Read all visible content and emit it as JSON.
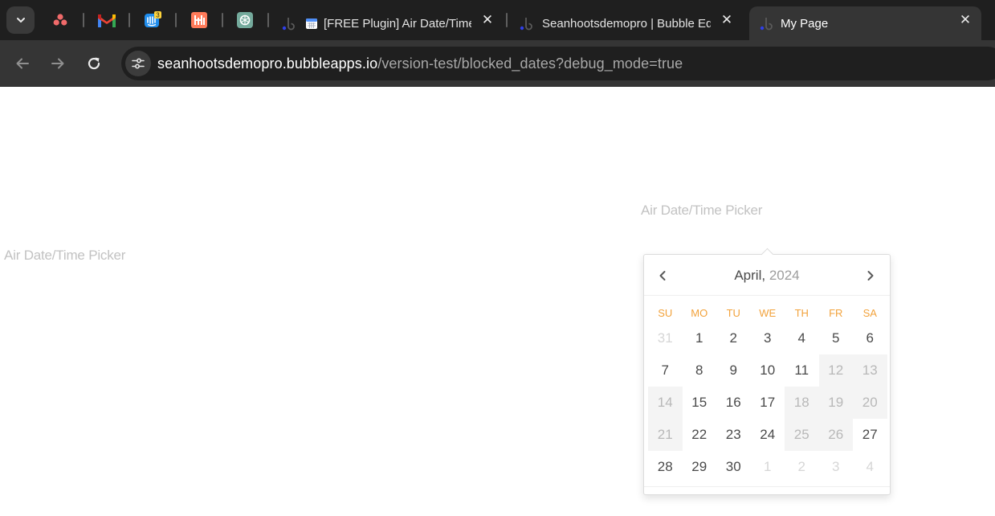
{
  "browser": {
    "pinned_tabs": [
      {
        "icon": "asana-icon",
        "color": "#f06a6a"
      },
      {
        "icon": "gmail-icon",
        "color": "#ea4335"
      },
      {
        "icon": "intercom-icon",
        "color": "#1f8ded",
        "badge": "3"
      },
      {
        "icon": "hubspot-icon",
        "color": "#ff7a59"
      },
      {
        "icon": "chatgpt-icon",
        "color": "#74aa9c"
      }
    ],
    "tabs": [
      {
        "title": "[FREE Plugin] Air Date/Time",
        "icon": "calendar-icon"
      },
      {
        "title": "Seanhootsdemopro | Bubble Ed",
        "icon": "bubble-icon"
      },
      {
        "title": "My Page",
        "icon": "bubble-icon",
        "active": true
      }
    ],
    "close_glyph": "✕",
    "url_host": "seanhootsdemopro.bubbleapps.io",
    "url_path": "/version-test/blocked_dates?debug_mode=true"
  },
  "page": {
    "left_input_placeholder": "Air Date/Time Picker",
    "right_input_placeholder": "Air Date/Time Picker"
  },
  "datepicker": {
    "month": "April,",
    "year": "2024",
    "weekdays": [
      "SU",
      "MO",
      "TU",
      "WE",
      "TH",
      "FR",
      "SA"
    ],
    "accent_color": "#f2a23b",
    "days": [
      {
        "label": "31",
        "state": "other"
      },
      {
        "label": "1",
        "state": "normal"
      },
      {
        "label": "2",
        "state": "normal"
      },
      {
        "label": "3",
        "state": "normal"
      },
      {
        "label": "4",
        "state": "normal"
      },
      {
        "label": "5",
        "state": "normal"
      },
      {
        "label": "6",
        "state": "normal"
      },
      {
        "label": "7",
        "state": "normal"
      },
      {
        "label": "8",
        "state": "normal"
      },
      {
        "label": "9",
        "state": "normal"
      },
      {
        "label": "10",
        "state": "normal"
      },
      {
        "label": "11",
        "state": "normal"
      },
      {
        "label": "12",
        "state": "blocked"
      },
      {
        "label": "13",
        "state": "blocked"
      },
      {
        "label": "14",
        "state": "blocked"
      },
      {
        "label": "15",
        "state": "normal"
      },
      {
        "label": "16",
        "state": "normal"
      },
      {
        "label": "17",
        "state": "normal"
      },
      {
        "label": "18",
        "state": "blocked"
      },
      {
        "label": "19",
        "state": "blocked"
      },
      {
        "label": "20",
        "state": "blocked"
      },
      {
        "label": "21",
        "state": "blocked"
      },
      {
        "label": "22",
        "state": "normal"
      },
      {
        "label": "23",
        "state": "normal"
      },
      {
        "label": "24",
        "state": "normal"
      },
      {
        "label": "25",
        "state": "blocked"
      },
      {
        "label": "26",
        "state": "blocked"
      },
      {
        "label": "27",
        "state": "normal"
      },
      {
        "label": "28",
        "state": "normal"
      },
      {
        "label": "29",
        "state": "normal"
      },
      {
        "label": "30",
        "state": "normal"
      },
      {
        "label": "1",
        "state": "other"
      },
      {
        "label": "2",
        "state": "other"
      },
      {
        "label": "3",
        "state": "other"
      },
      {
        "label": "4",
        "state": "other"
      }
    ]
  }
}
